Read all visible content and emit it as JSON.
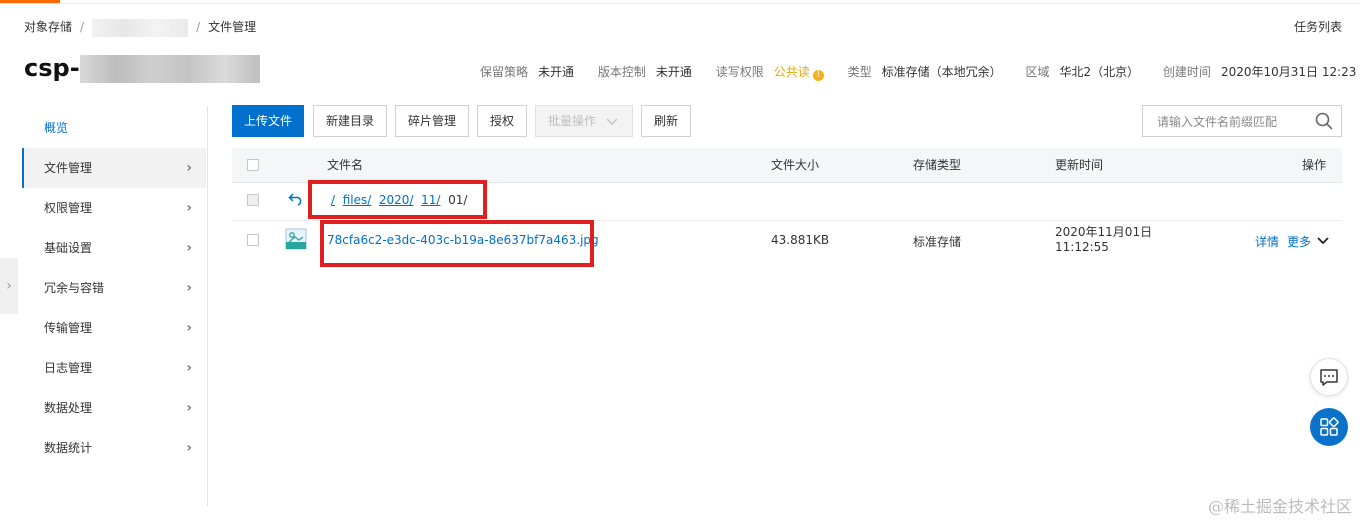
{
  "breadcrumb": {
    "root": "对象存储",
    "sep": "/",
    "current": "文件管理"
  },
  "header_right": {
    "tasklist": "任务列表"
  },
  "bucket": {
    "title_prefix": "csp-"
  },
  "meta": [
    {
      "key": "保留策略",
      "value": "未开通"
    },
    {
      "key": "版本控制",
      "value": "未开通"
    },
    {
      "key": "读写权限",
      "value": "公共读",
      "warn": "!"
    },
    {
      "key": "类型",
      "value": "标准存储（本地冗余）"
    },
    {
      "key": "区域",
      "value": "华北2（北京）"
    },
    {
      "key": "创建时间",
      "value": "2020年10月31日 12:23"
    }
  ],
  "sidebar": {
    "items": [
      {
        "label": "概览"
      },
      {
        "label": "文件管理"
      },
      {
        "label": "权限管理"
      },
      {
        "label": "基础设置"
      },
      {
        "label": "冗余与容错"
      },
      {
        "label": "传输管理"
      },
      {
        "label": "日志管理"
      },
      {
        "label": "数据处理"
      },
      {
        "label": "数据统计"
      }
    ],
    "chevron": "›",
    "collapse": "›"
  },
  "toolbar": {
    "upload": "上传文件",
    "new_dir": "新建目录",
    "fragments": "碎片管理",
    "authorize": "授权",
    "batch": "批量操作",
    "refresh": "刷新",
    "search_placeholder": "请输入文件名前缀匹配"
  },
  "table": {
    "headers": {
      "name": "文件名",
      "size": "文件大小",
      "storage": "存储类型",
      "updated": "更新时间",
      "ops": "操作"
    },
    "path": {
      "root": "/",
      "seg1": "files/",
      "seg2": "2020/",
      "seg3": "11/",
      "current": "01/"
    },
    "rows": [
      {
        "name": "78cfa6c2-e3dc-403c-b19a-8e637bf7a463.jpg",
        "size": "43.881KB",
        "storage": "标准存储",
        "date": "2020年11月01日",
        "time": "11:12:55",
        "detail": "详情",
        "more": "更多"
      }
    ]
  },
  "watermark": "@稀土掘金技术社区",
  "colors": {
    "primary": "#0070cc",
    "accent": "#ff6a00",
    "highlight": "#e02020",
    "warning": "#f5b01a"
  }
}
